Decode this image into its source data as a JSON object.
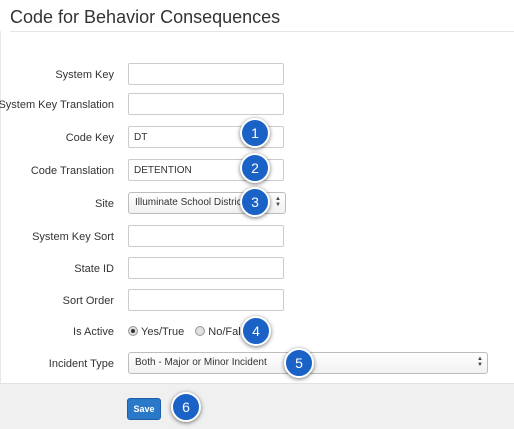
{
  "page": {
    "title": "Code for Behavior Consequences"
  },
  "fields": {
    "system_key": {
      "label": "System Key",
      "value": ""
    },
    "system_key_translation": {
      "label": "System Key Translation",
      "value": ""
    },
    "code_key": {
      "label": "Code Key",
      "value": "DT"
    },
    "code_translation": {
      "label": "Code Translation",
      "value": "DETENTION"
    },
    "site": {
      "label": "Site",
      "selected": "Illuminate School District"
    },
    "system_key_sort": {
      "label": "System Key Sort",
      "value": ""
    },
    "state_id": {
      "label": "State ID",
      "value": ""
    },
    "sort_order": {
      "label": "Sort Order",
      "value": ""
    },
    "is_active": {
      "label": "Is Active",
      "option_true": "Yes/True",
      "option_false": "No/False",
      "selected": "Yes/True"
    },
    "incident_type": {
      "label": "Incident Type",
      "selected": "Both - Major or Minor Incident"
    }
  },
  "actions": {
    "save_label": "Save"
  },
  "callouts": [
    "1",
    "2",
    "3",
    "4",
    "5",
    "6"
  ],
  "colors": {
    "callout": "#1b62c7",
    "primary_button": "#2a78c8",
    "footer_bg": "#f0f0f0"
  }
}
